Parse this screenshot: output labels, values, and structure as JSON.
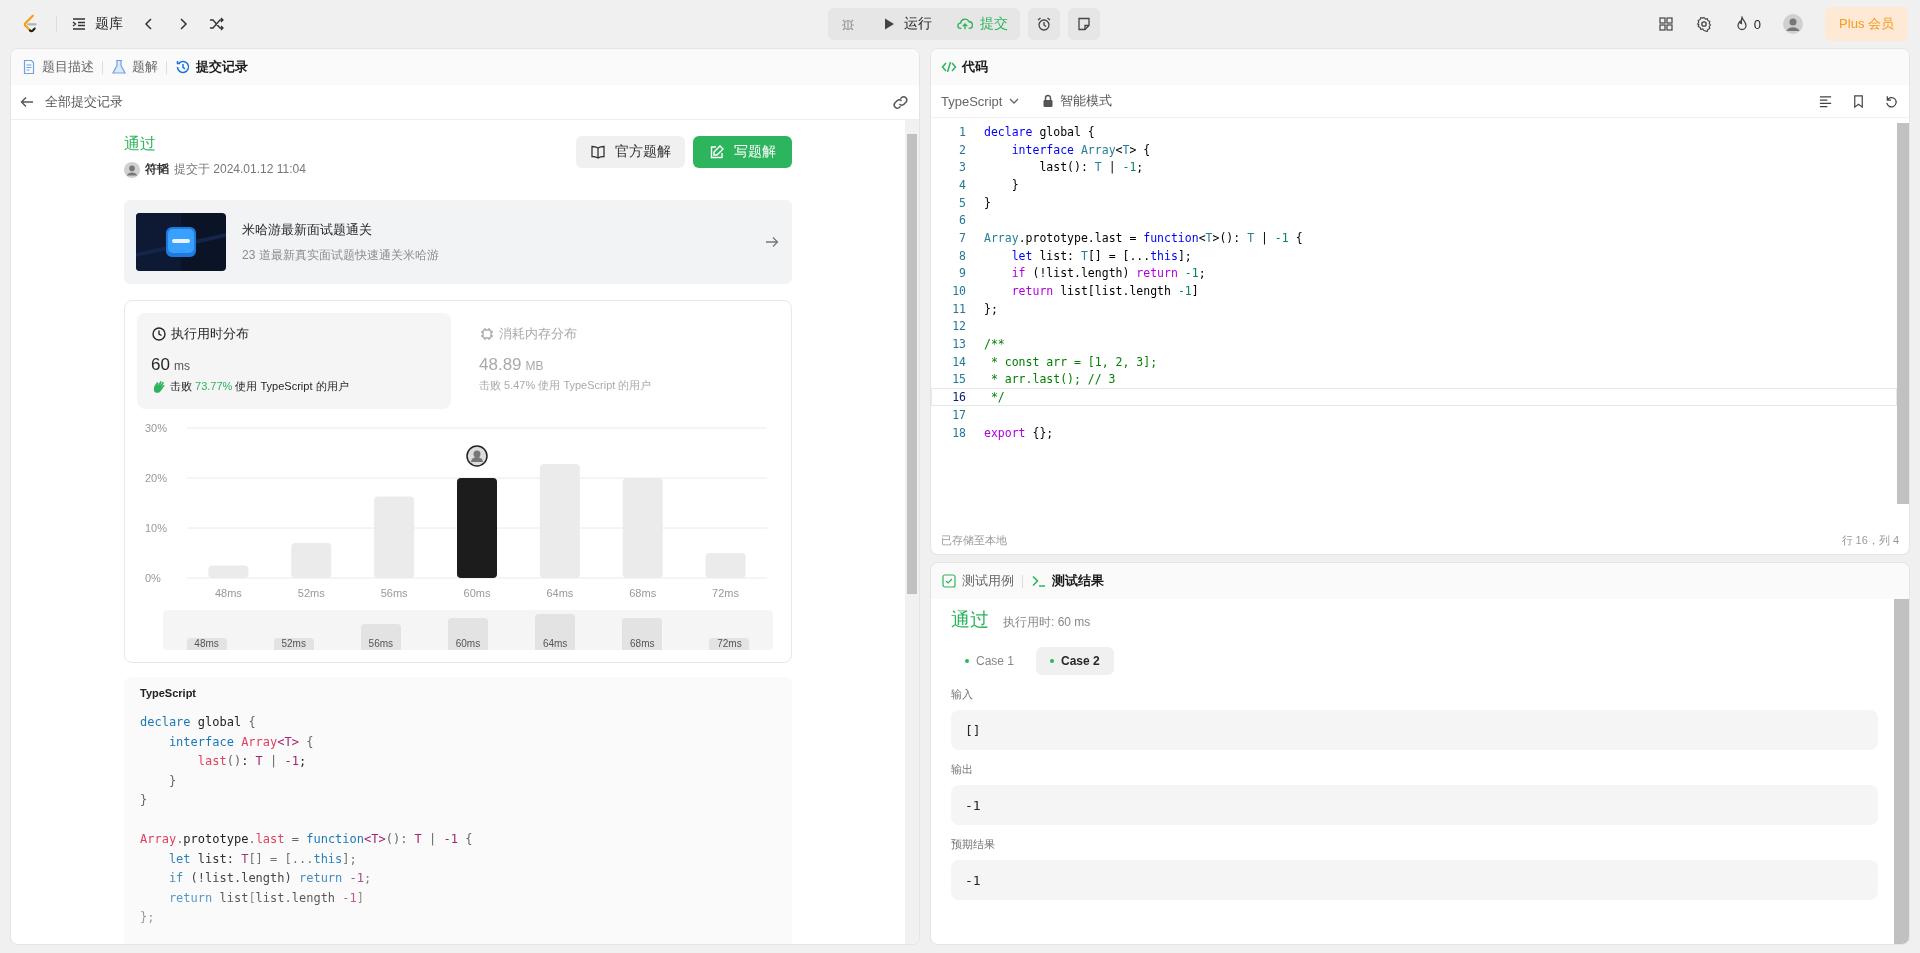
{
  "top_bar": {
    "problem_list": "题库",
    "run": "运行",
    "submit": "提交",
    "fire_count": "0",
    "plus": "Plus 会员"
  },
  "left_panel": {
    "tabs": [
      {
        "label": "题目描述",
        "selected": false
      },
      {
        "label": "题解",
        "selected": false
      },
      {
        "label": "提交记录",
        "selected": true
      }
    ],
    "back_label": "全部提交记录",
    "submission": {
      "status": "通过",
      "author": "符韬",
      "submitted_at": "提交于 2024.01.12 11:04",
      "official_button": "官方题解",
      "write_button": "写题解"
    },
    "promo": {
      "kind": "picture",
      "title": "米哈游最新面试题通关",
      "subtitle": "23 道最新真实面试题快速通关米哈游"
    },
    "stats": [
      {
        "title": "执行用时分布",
        "value": "60",
        "unit": "ms",
        "beats": "击败",
        "percent": "73.77%",
        "users": "使用 TypeScript 的用户",
        "selected": true
      },
      {
        "title": "消耗内存分布",
        "value": "48.89",
        "unit": "MB",
        "beats": "击败",
        "percent": "5.47%",
        "users": "使用 TypeScript 的用户",
        "selected": false
      }
    ],
    "chart_data": {
      "type": "bar",
      "categories": [
        "48ms",
        "52ms",
        "56ms",
        "60ms",
        "64ms",
        "68ms",
        "72ms"
      ],
      "values": [
        2.5,
        7,
        16.3,
        20,
        22.8,
        20,
        5
      ],
      "ylim": [
        0,
        30
      ],
      "yticks": [
        {
          "value": 0,
          "label": "0%"
        },
        {
          "value": 10,
          "label": "10%"
        },
        {
          "value": 20,
          "label": "20%"
        },
        {
          "value": 30,
          "label": "30%"
        }
      ]
    },
    "bars": [
      {
        "selected": false
      },
      {
        "selected": false
      },
      {
        "selected": false
      },
      {
        "selected": true
      },
      {
        "selected": false
      },
      {
        "selected": false
      },
      {
        "selected": false
      }
    ],
    "overview_labels": [
      "48ms",
      "52ms",
      "56ms",
      "60ms",
      "64ms",
      "68ms",
      "72ms"
    ],
    "code": {
      "language": "TypeScript",
      "blocks": [
        [
          {
            "tokens": [
              {
                "text": "declare",
                "kind": "kw"
              },
              {
                "text": " global ",
                "kind": "plain"
              },
              {
                "text": "{",
                "kind": "punct"
              }
            ]
          },
          {
            "tokens": [
              {
                "text": "    interface",
                "kind": "kw"
              },
              {
                "text": " Array",
                "kind": "prop"
              },
              {
                "text": "<T>",
                "kind": "type"
              },
              {
                "text": " {",
                "kind": "punct"
              }
            ]
          },
          {
            "tokens": [
              {
                "text": "        last",
                "kind": "prop"
              },
              {
                "text": "()",
                "kind": "punct"
              },
              {
                "text": ": ",
                "kind": "plain"
              },
              {
                "text": "T",
                "kind": "type"
              },
              {
                "text": " | ",
                "kind": "punct"
              },
              {
                "text": "-1",
                "kind": "num"
              },
              {
                "text": ";",
                "kind": "plain"
              }
            ]
          },
          {
            "tokens": [
              {
                "text": "    }",
                "kind": "punct"
              }
            ]
          },
          {
            "tokens": [
              {
                "text": "}",
                "kind": "punct"
              }
            ]
          }
        ],
        [
          {
            "tokens": [
              {
                "text": "Array",
                "kind": "prop"
              },
              {
                "text": ".",
                "kind": "punct"
              },
              {
                "text": "prototype",
                "kind": "plain"
              },
              {
                "text": ".",
                "kind": "punct"
              },
              {
                "text": "last",
                "kind": "prop"
              },
              {
                "text": " = ",
                "kind": "punct"
              },
              {
                "text": "function",
                "kind": "kw"
              },
              {
                "text": "<T>",
                "kind": "type"
              },
              {
                "text": "(): ",
                "kind": "punct"
              },
              {
                "text": "T",
                "kind": "type"
              },
              {
                "text": " | ",
                "kind": "punct"
              },
              {
                "text": "-1",
                "kind": "num"
              },
              {
                "text": " {",
                "kind": "punct"
              }
            ]
          },
          {
            "tokens": [
              {
                "text": "    let",
                "kind": "kw"
              },
              {
                "text": " list: ",
                "kind": "plain"
              },
              {
                "text": "T",
                "kind": "type"
              },
              {
                "text": "[] = [...",
                "kind": "punct"
              },
              {
                "text": "this",
                "kind": "kw"
              },
              {
                "text": "];",
                "kind": "punct"
              }
            ]
          },
          {
            "tokens": [
              {
                "text": "    if",
                "kind": "kw"
              },
              {
                "text": " (!list.length) ",
                "kind": "plain"
              },
              {
                "text": "return ",
                "kind": "kw"
              },
              {
                "text": "-1",
                "kind": "num"
              },
              {
                "text": ";",
                "kind": "punct"
              }
            ]
          },
          {
            "tokens": [
              {
                "text": "    return",
                "kind": "kw"
              },
              {
                "text": " list",
                "kind": "plain"
              },
              {
                "text": "[",
                "kind": "punct"
              },
              {
                "text": "list.length ",
                "kind": "plain"
              },
              {
                "text": "-1",
                "kind": "num"
              },
              {
                "text": "]",
                "kind": "punct"
              }
            ]
          },
          {
            "tokens": [
              {
                "text": "};",
                "kind": "punct"
              }
            ]
          }
        ]
      ]
    }
  },
  "editor": {
    "title": "代码",
    "language": "TypeScript",
    "mode": "智能模式",
    "saved": "已存储至本地",
    "cursor": "行 16，列 4",
    "lines": [
      {
        "number": "1",
        "current": false,
        "tokens": [
          {
            "text": "declare",
            "kind": "kw"
          },
          {
            "text": " global {",
            "kind": "plain"
          }
        ]
      },
      {
        "number": "2",
        "current": false,
        "tokens": [
          {
            "text": "    interface ",
            "kind": "kw"
          },
          {
            "text": "Array",
            "kind": "type"
          },
          {
            "text": "<",
            "kind": "plain"
          },
          {
            "text": "T",
            "kind": "type"
          },
          {
            "text": "> {",
            "kind": "plain"
          }
        ]
      },
      {
        "number": "3",
        "current": false,
        "tokens": [
          {
            "text": "        last(): ",
            "kind": "plain"
          },
          {
            "text": "T",
            "kind": "type"
          },
          {
            "text": " | ",
            "kind": "plain"
          },
          {
            "text": "-1",
            "kind": "num"
          },
          {
            "text": ";",
            "kind": "plain"
          }
        ]
      },
      {
        "number": "4",
        "current": false,
        "tokens": [
          {
            "text": "    }",
            "kind": "plain"
          }
        ]
      },
      {
        "number": "5",
        "current": false,
        "tokens": [
          {
            "text": "}",
            "kind": "plain"
          }
        ]
      },
      {
        "number": "6",
        "current": false
      },
      {
        "number": "7",
        "current": false,
        "tokens": [
          {
            "text": "Array",
            "kind": "type"
          },
          {
            "text": ".prototype.last = ",
            "kind": "plain"
          },
          {
            "text": "function",
            "kind": "kw"
          },
          {
            "text": "<",
            "kind": "plain"
          },
          {
            "text": "T",
            "kind": "type"
          },
          {
            "text": ">(): ",
            "kind": "plain"
          },
          {
            "text": "T",
            "kind": "type"
          },
          {
            "text": " | ",
            "kind": "plain"
          },
          {
            "text": "-1",
            "kind": "num"
          },
          {
            "text": " {",
            "kind": "plain"
          }
        ]
      },
      {
        "number": "8",
        "current": false,
        "tokens": [
          {
            "text": "    let",
            "kind": "kw"
          },
          {
            "text": " list: ",
            "kind": "plain"
          },
          {
            "text": "T",
            "kind": "type"
          },
          {
            "text": "[] = [...",
            "kind": "plain"
          },
          {
            "text": "this",
            "kind": "kw"
          },
          {
            "text": "];",
            "kind": "plain"
          }
        ]
      },
      {
        "number": "9",
        "current": false,
        "tokens": [
          {
            "text": "    if",
            "kind": "ctrl"
          },
          {
            "text": " (!list.length) ",
            "kind": "plain"
          },
          {
            "text": "return ",
            "kind": "ctrl"
          },
          {
            "text": "-1",
            "kind": "num"
          },
          {
            "text": ";",
            "kind": "plain"
          }
        ]
      },
      {
        "number": "10",
        "current": false,
        "tokens": [
          {
            "text": "    return",
            "kind": "ctrl"
          },
          {
            "text": " list[list.length ",
            "kind": "plain"
          },
          {
            "text": "-1",
            "kind": "num"
          },
          {
            "text": "]",
            "kind": "plain"
          }
        ]
      },
      {
        "number": "11",
        "current": false,
        "tokens": [
          {
            "text": "};",
            "kind": "plain"
          }
        ]
      },
      {
        "number": "12",
        "current": false
      },
      {
        "number": "13",
        "current": false,
        "tokens": [
          {
            "text": "/**",
            "kind": "comment"
          }
        ]
      },
      {
        "number": "14",
        "current": false,
        "tokens": [
          {
            "text": " * const arr = [1, 2, 3];",
            "kind": "comment"
          }
        ]
      },
      {
        "number": "15",
        "current": false,
        "tokens": [
          {
            "text": " * arr.last(); // 3",
            "kind": "comment"
          }
        ]
      },
      {
        "number": "16",
        "current": true,
        "tokens": [
          {
            "text": " */",
            "kind": "comment"
          }
        ]
      },
      {
        "number": "17",
        "current": false
      },
      {
        "number": "18",
        "current": false,
        "tokens": [
          {
            "text": "export",
            "kind": "ctrl"
          },
          {
            "text": " {};",
            "kind": "plain"
          }
        ]
      }
    ]
  },
  "test_panel": {
    "tabs": [
      {
        "label": "测试用例",
        "selected": false
      },
      {
        "label": "测试结果",
        "selected": true
      }
    ],
    "status": "通过",
    "runtime": "执行用时: 60 ms",
    "cases": [
      {
        "label": "Case 1",
        "selected": false
      },
      {
        "label": "Case 2",
        "selected": true
      }
    ],
    "fields": [
      {
        "label": "输入",
        "value": "[]"
      },
      {
        "label": "输出",
        "value": "-1"
      },
      {
        "label": "预期结果",
        "value": "-1"
      }
    ]
  }
}
